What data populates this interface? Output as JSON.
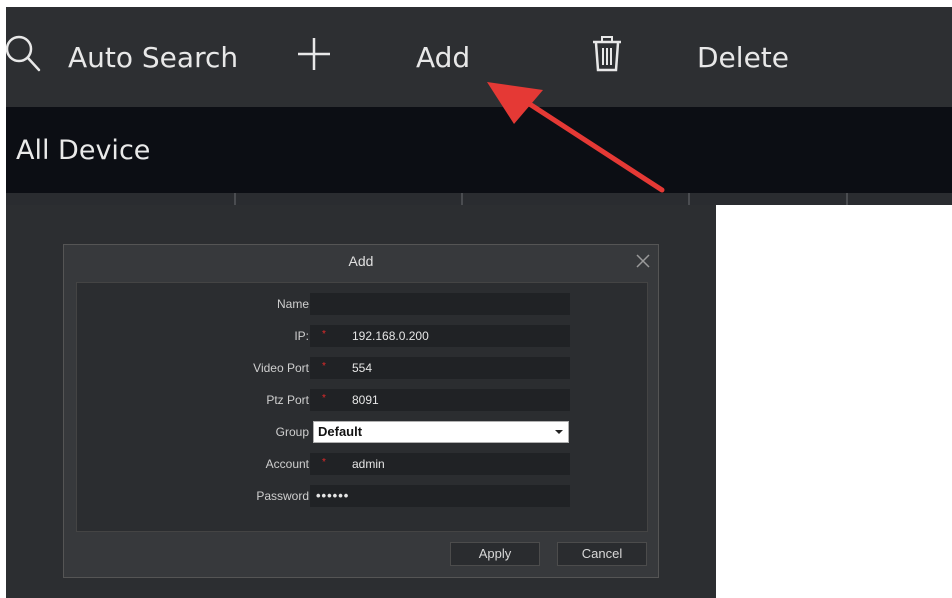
{
  "toolbar": {
    "auto_search_label": "Auto Search",
    "add_label": "Add",
    "delete_label": "Delete"
  },
  "device_bar": {
    "title": "All Device"
  },
  "dialog": {
    "title": "Add",
    "fields": [
      {
        "label": "Name",
        "value": "",
        "required": false
      },
      {
        "label": "IP:",
        "value": "192.168.0.200",
        "required": true
      },
      {
        "label": "Video Port",
        "value": "554",
        "required": true
      },
      {
        "label": "Ptz Port",
        "value": "8091",
        "required": true
      },
      {
        "label": "Group",
        "value": "Default",
        "required": false
      },
      {
        "label": "Account",
        "value": "admin",
        "required": true
      },
      {
        "label": "Password",
        "value": "••••••",
        "required": false
      }
    ],
    "required_mark": "*",
    "apply_label": "Apply",
    "cancel_label": "Cancel"
  },
  "icons": [
    "search-icon",
    "plus-icon",
    "trash-icon",
    "close-icon",
    "chevron-down-icon",
    "annotation-arrow"
  ],
  "colors": {
    "toolbar_bg": "#2d2f32",
    "device_bar_bg": "#0c0e14",
    "dialog_bg": "#37393c",
    "arrow": "#e53935"
  }
}
